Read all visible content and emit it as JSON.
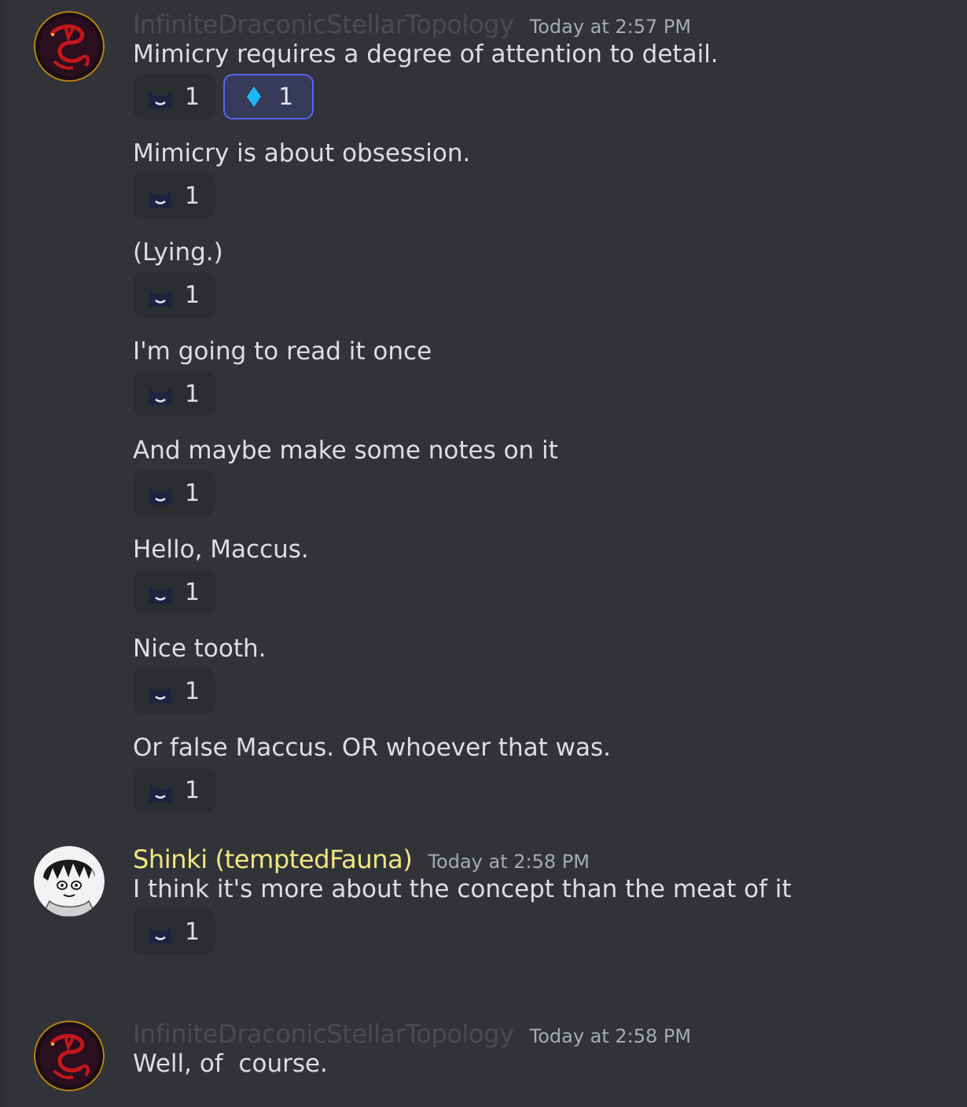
{
  "colors": {
    "background": "#323339",
    "reaction_bg": "#2b2d31",
    "reaction_active_bg": "#373a59",
    "reaction_active_border": "#5865f2",
    "username_1": "#4a4b4f",
    "username_2": "#f0e782",
    "timestamp": "#a7aab2",
    "text": "#dcdee1"
  },
  "groups": [
    {
      "username": "InfiniteDraconicStellarTopology",
      "timestamp": "Today at 2:57 PM",
      "avatar_icon": "red-dragon-sigil-avatar",
      "messages": [
        {
          "text": "Mimicry requires a degree of attention to detail.",
          "reactions": [
            {
              "emoji": "dark-cat-smile-emoji",
              "count": "1",
              "active": false
            },
            {
              "emoji": "blue-diamond-emoji",
              "count": "1",
              "active": true
            }
          ]
        },
        {
          "text": "Mimicry is about obsession.",
          "reactions": [
            {
              "emoji": "dark-cat-smile-emoji",
              "count": "1",
              "active": false
            }
          ]
        },
        {
          "text": "(Lying.)",
          "reactions": [
            {
              "emoji": "dark-cat-smile-emoji",
              "count": "1",
              "active": false
            }
          ]
        },
        {
          "text": "I'm going to read it once",
          "reactions": [
            {
              "emoji": "dark-cat-smile-emoji",
              "count": "1",
              "active": false
            }
          ]
        },
        {
          "text": "And maybe make some notes on it",
          "reactions": [
            {
              "emoji": "dark-cat-smile-emoji",
              "count": "1",
              "active": false
            }
          ]
        },
        {
          "text": "Hello, Maccus.",
          "reactions": [
            {
              "emoji": "dark-cat-smile-emoji",
              "count": "1",
              "active": false
            }
          ]
        },
        {
          "text": "Nice tooth.",
          "reactions": [
            {
              "emoji": "dark-cat-smile-emoji",
              "count": "1",
              "active": false
            }
          ]
        },
        {
          "text": "Or false Maccus. OR whoever that was.",
          "reactions": [
            {
              "emoji": "dark-cat-smile-emoji",
              "count": "1",
              "active": false
            }
          ]
        }
      ]
    },
    {
      "username": "Shinki (temptedFauna)",
      "timestamp": "Today at 2:58 PM",
      "avatar_icon": "manga-girl-avatar",
      "messages": [
        {
          "text": "I think it's more about the concept than the meat of it",
          "reactions": [
            {
              "emoji": "dark-cat-smile-emoji",
              "count": "1",
              "active": false
            }
          ]
        }
      ]
    },
    {
      "username": "InfiniteDraconicStellarTopology",
      "timestamp": "Today at 2:58 PM",
      "avatar_icon": "red-dragon-sigil-avatar",
      "messages": [
        {
          "text": "Well, of  course.",
          "reactions": []
        }
      ]
    }
  ]
}
